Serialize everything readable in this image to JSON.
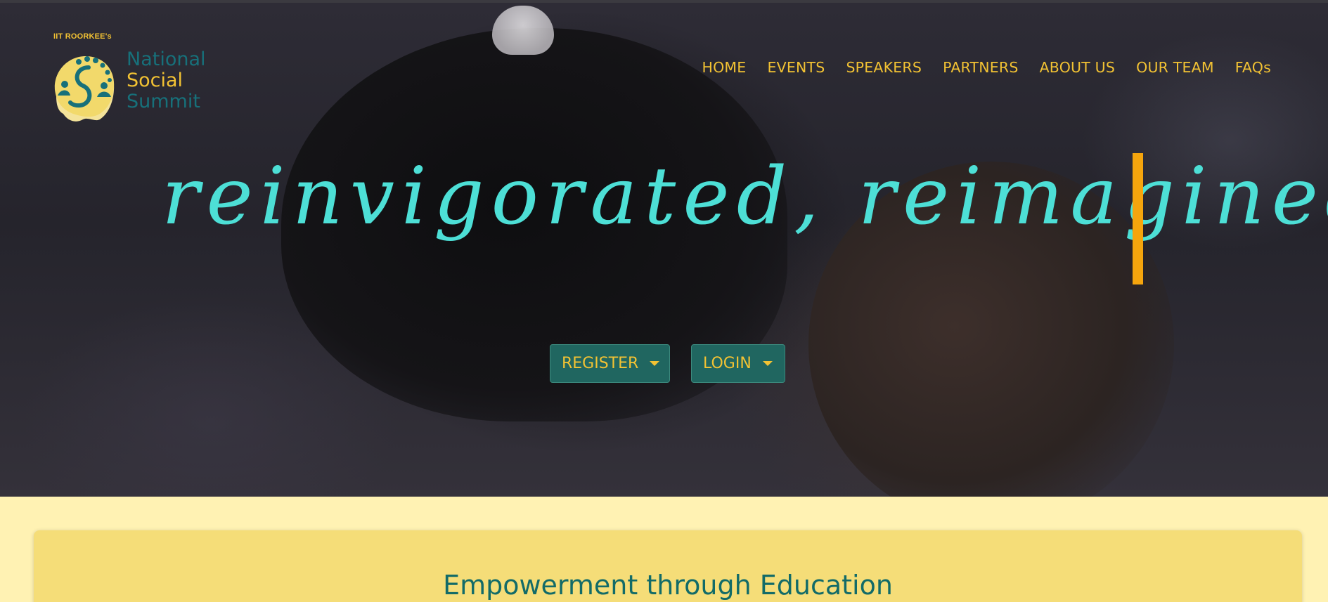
{
  "logo": {
    "tagline": "IIT ROORKEE's",
    "word1": "National",
    "word2": "Social",
    "word3": "Summit"
  },
  "nav": {
    "items": [
      {
        "label": "HOME"
      },
      {
        "label": "EVENTS"
      },
      {
        "label": "SPEAKERS"
      },
      {
        "label": "PARTNERS"
      },
      {
        "label": "ABOUT US"
      },
      {
        "label": "OUR TEAM"
      },
      {
        "label": "FAQs"
      }
    ]
  },
  "hero": {
    "headline": "reinvigorated, reimagined",
    "register_label": "REGISTER",
    "login_label": "LOGIN"
  },
  "card": {
    "title": "Empowerment through Education"
  },
  "colors": {
    "accent_yellow": "#f2c233",
    "headline_cyan": "#4ddfd6",
    "cursor_orange": "#f5a50d",
    "button_teal": "#206660",
    "card_yellow": "#f5dd78",
    "page_cream": "#fff2b3",
    "title_teal": "#126b68"
  }
}
